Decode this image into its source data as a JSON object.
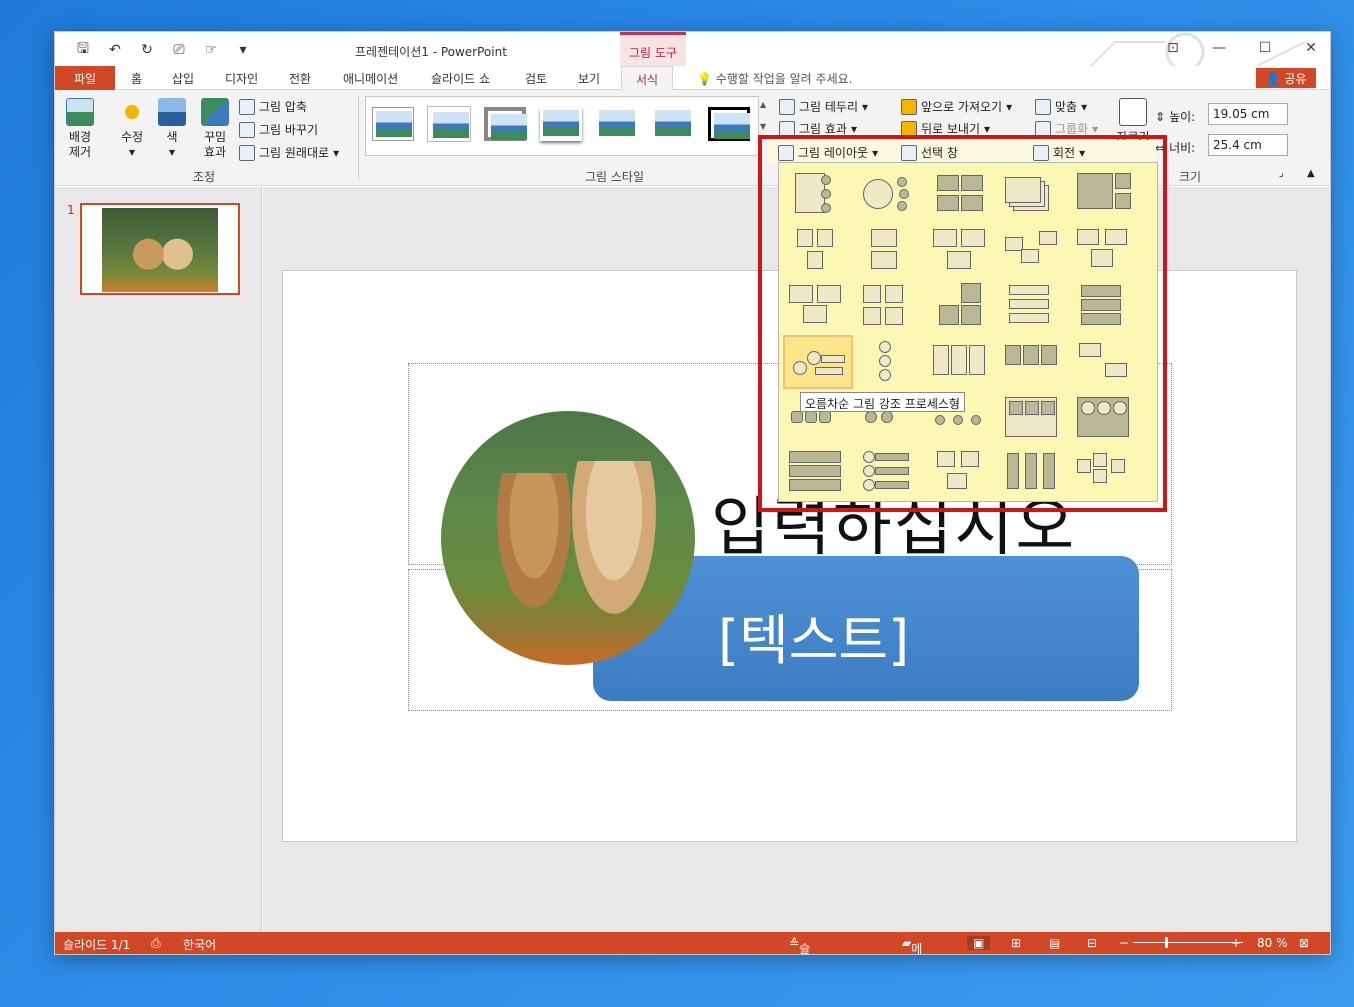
{
  "window": {
    "title": "프레젠테이션1 - PowerPoint",
    "tools_tab": "그림 도구",
    "min_icon": "minimize-icon",
    "max_icon": "maximize-icon",
    "close_icon": "close-icon"
  },
  "tabs": [
    {
      "label": "파일"
    },
    {
      "label": "홈"
    },
    {
      "label": "삽입"
    },
    {
      "label": "디자인"
    },
    {
      "label": "전환"
    },
    {
      "label": "애니메이션"
    },
    {
      "label": "슬라이드 쇼"
    },
    {
      "label": "검토"
    },
    {
      "label": "보기"
    },
    {
      "label": "서식"
    }
  ],
  "tellme": "수행할 작업을 알려 주세요.",
  "share": "공유",
  "ribbon": {
    "remove_bg": "배경\n제거",
    "corrections": "수정",
    "color": "색",
    "artistic": "꾸밈\n효과",
    "compress": "그림 압축",
    "change": "그림 바꾸기",
    "reset": "그림 원래대로",
    "adjust_group": "조정",
    "styles_group": "그림 스타일",
    "border": "그림 테두리",
    "effects": "그림 효과",
    "layout": "그림 레이아웃",
    "bring_forward": "앞으로 가져오기",
    "send_backward": "뒤로 보내기",
    "selection_pane": "선택 창",
    "align": "맞춤",
    "group": "그룹화",
    "rotate": "회전",
    "crop": "자르기",
    "height_label": "높이:",
    "height_value": "19.05 cm",
    "width_label": "너비:",
    "width_value": "25.4 cm",
    "size_group": "크기"
  },
  "slides": {
    "number": "1"
  },
  "slide": {
    "title_text": "입력하십시오",
    "body_text": "[텍스트]"
  },
  "layout_tooltip": "오름차순 그림 강조 프로세스형",
  "status": {
    "slide": "슬라이드 1/1",
    "language": "한국어",
    "notes": "슬라이드 노트",
    "comments": "메모",
    "zoom": "80 %"
  },
  "colors": {
    "accent": "#d24726",
    "highlight_box": "#d21414",
    "dropdown_bg": "#fdf7b4"
  }
}
